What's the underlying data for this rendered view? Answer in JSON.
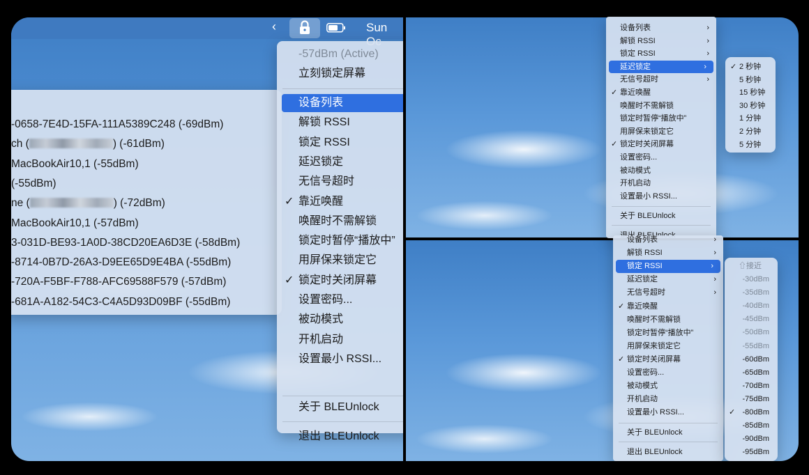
{
  "menubar": {
    "chevron": "‹",
    "time": "Sun Oc"
  },
  "main_menu": {
    "status": "-57dBm (Active)",
    "lock_now": "立刻锁定屏幕",
    "items": [
      {
        "label": "设备列表",
        "highlighted": true,
        "checked": false
      },
      {
        "label": "解锁 RSSI",
        "highlighted": false,
        "checked": false
      },
      {
        "label": "锁定 RSSI",
        "highlighted": false,
        "checked": false
      },
      {
        "label": "延迟锁定",
        "highlighted": false,
        "checked": false
      },
      {
        "label": "无信号超时",
        "highlighted": false,
        "checked": false
      },
      {
        "label": "靠近唤醒",
        "highlighted": false,
        "checked": true
      },
      {
        "label": "唤醒时不需解锁",
        "highlighted": false,
        "checked": false
      },
      {
        "label": "锁定时暂停“播放中”",
        "highlighted": false,
        "checked": false
      },
      {
        "label": "用屏保来锁定它",
        "highlighted": false,
        "checked": false
      },
      {
        "label": "锁定时关闭屏幕",
        "highlighted": false,
        "checked": true
      },
      {
        "label": "设置密码...",
        "highlighted": false,
        "checked": false
      },
      {
        "label": "被动模式",
        "highlighted": false,
        "checked": false
      },
      {
        "label": "开机启动",
        "highlighted": false,
        "checked": false
      },
      {
        "label": "设置最小 RSSI...",
        "highlighted": false,
        "checked": false
      }
    ],
    "about": "关于 BLEUnlock",
    "quit": "退出 BLEUnlock"
  },
  "device_list": {
    "items": [
      {
        "prefix": "-0658-7E4D-15FA-111A5389C248 (-69dBm)",
        "blurred": false,
        "suffix": ""
      },
      {
        "prefix": "ch (",
        "blurred": true,
        "suffix": ") (-61dBm)"
      },
      {
        "prefix": "MacBookAir10,1 (-55dBm)",
        "blurred": false,
        "suffix": ""
      },
      {
        "prefix": "(-55dBm)",
        "blurred": false,
        "suffix": ""
      },
      {
        "prefix": "ne (",
        "blurred": true,
        "suffix": ") (-72dBm)"
      },
      {
        "prefix": "MacBookAir10,1 (-57dBm)",
        "blurred": false,
        "suffix": ""
      },
      {
        "prefix": "3-031D-BE93-1A0D-38CD20EA6D3E (-58dBm)",
        "blurred": false,
        "suffix": ""
      },
      {
        "prefix": "-8714-0B7D-26A3-D9EE65D9E4BA (-55dBm)",
        "blurred": false,
        "suffix": ""
      },
      {
        "prefix": "-720A-F5BF-F788-AFC69588F579 (-57dBm)",
        "blurred": false,
        "suffix": ""
      },
      {
        "prefix": "-681A-A182-54C3-C4A5D93D09BF (-55dBm)",
        "blurred": false,
        "suffix": ""
      }
    ]
  },
  "tr_menu": {
    "items": [
      {
        "label": "设备列表",
        "submenu": true,
        "checked": false,
        "highlighted": false
      },
      {
        "label": "解锁 RSSI",
        "submenu": true,
        "checked": false,
        "highlighted": false
      },
      {
        "label": "锁定 RSSI",
        "submenu": true,
        "checked": false,
        "highlighted": false
      },
      {
        "label": "延迟锁定",
        "submenu": true,
        "checked": false,
        "highlighted": true
      },
      {
        "label": "无信号超时",
        "submenu": true,
        "checked": false,
        "highlighted": false
      },
      {
        "label": "靠近唤醒",
        "submenu": false,
        "checked": true,
        "highlighted": false
      },
      {
        "label": "唤醒时不需解锁",
        "submenu": false,
        "checked": false,
        "highlighted": false
      },
      {
        "label": "锁定时暂停“播放中”",
        "submenu": false,
        "checked": false,
        "highlighted": false
      },
      {
        "label": "用屏保来锁定它",
        "submenu": false,
        "checked": false,
        "highlighted": false
      },
      {
        "label": "锁定时关闭屏幕",
        "submenu": false,
        "checked": true,
        "highlighted": false
      },
      {
        "label": "设置密码...",
        "submenu": false,
        "checked": false,
        "highlighted": false
      },
      {
        "label": "被动模式",
        "submenu": false,
        "checked": false,
        "highlighted": false
      },
      {
        "label": "开机启动",
        "submenu": false,
        "checked": false,
        "highlighted": false
      },
      {
        "label": "设置最小 RSSI...",
        "submenu": false,
        "checked": false,
        "highlighted": false
      }
    ],
    "about": "关于 BLEUnlock",
    "quit": "退出 BLEUnlock"
  },
  "tr_sub": {
    "items": [
      {
        "label": "2 秒钟",
        "checked": true
      },
      {
        "label": "5 秒钟",
        "checked": false
      },
      {
        "label": "15 秒钟",
        "checked": false
      },
      {
        "label": "30 秒钟",
        "checked": false
      },
      {
        "label": "1 分钟",
        "checked": false
      },
      {
        "label": "2 分钟",
        "checked": false
      },
      {
        "label": "5 分钟",
        "checked": false
      }
    ]
  },
  "br_menu": {
    "items": [
      {
        "label": "设备列表",
        "submenu": true,
        "checked": false,
        "highlighted": false
      },
      {
        "label": "解锁 RSSI",
        "submenu": true,
        "checked": false,
        "highlighted": false
      },
      {
        "label": "锁定 RSSI",
        "submenu": true,
        "checked": false,
        "highlighted": true
      },
      {
        "label": "延迟锁定",
        "submenu": true,
        "checked": false,
        "highlighted": false
      },
      {
        "label": "无信号超时",
        "submenu": true,
        "checked": false,
        "highlighted": false
      },
      {
        "label": "靠近唤醒",
        "submenu": false,
        "checked": true,
        "highlighted": false
      },
      {
        "label": "唤醒时不需解锁",
        "submenu": false,
        "checked": false,
        "highlighted": false
      },
      {
        "label": "锁定时暂停“播放中”",
        "submenu": false,
        "checked": false,
        "highlighted": false
      },
      {
        "label": "用屏保来锁定它",
        "submenu": false,
        "checked": false,
        "highlighted": false
      },
      {
        "label": "锁定时关闭屏幕",
        "submenu": false,
        "checked": true,
        "highlighted": false
      },
      {
        "label": "设置密码...",
        "submenu": false,
        "checked": false,
        "highlighted": false
      },
      {
        "label": "被动模式",
        "submenu": false,
        "checked": false,
        "highlighted": false
      },
      {
        "label": "开机启动",
        "submenu": false,
        "checked": false,
        "highlighted": false
      },
      {
        "label": "设置最小 RSSI...",
        "submenu": false,
        "checked": false,
        "highlighted": false
      }
    ],
    "about": "关于 BLEUnlock",
    "quit": "退出 BLEUnlock"
  },
  "br_sub": {
    "header": "⇧接近",
    "items": [
      {
        "label": "-30dBm",
        "checked": false,
        "disabled": true
      },
      {
        "label": "-35dBm",
        "checked": false,
        "disabled": true
      },
      {
        "label": "-40dBm",
        "checked": false,
        "disabled": true
      },
      {
        "label": "-45dBm",
        "checked": false,
        "disabled": true
      },
      {
        "label": "-50dBm",
        "checked": false,
        "disabled": true
      },
      {
        "label": "-55dBm",
        "checked": false,
        "disabled": true
      },
      {
        "label": "-60dBm",
        "checked": false,
        "disabled": false
      },
      {
        "label": "-65dBm",
        "checked": false,
        "disabled": false
      },
      {
        "label": "-70dBm",
        "checked": false,
        "disabled": false
      },
      {
        "label": "-75dBm",
        "checked": false,
        "disabled": false
      },
      {
        "label": "-80dBm",
        "checked": true,
        "disabled": false
      },
      {
        "label": "-85dBm",
        "checked": false,
        "disabled": false
      },
      {
        "label": "-90dBm",
        "checked": false,
        "disabled": false
      },
      {
        "label": "-95dBm",
        "checked": false,
        "disabled": false
      }
    ]
  },
  "glyphs": {
    "check": "✓",
    "submenu_arrow": "›"
  },
  "colors": {
    "highlight": "#2f6fe0",
    "menubar": "#3f7ac0"
  }
}
